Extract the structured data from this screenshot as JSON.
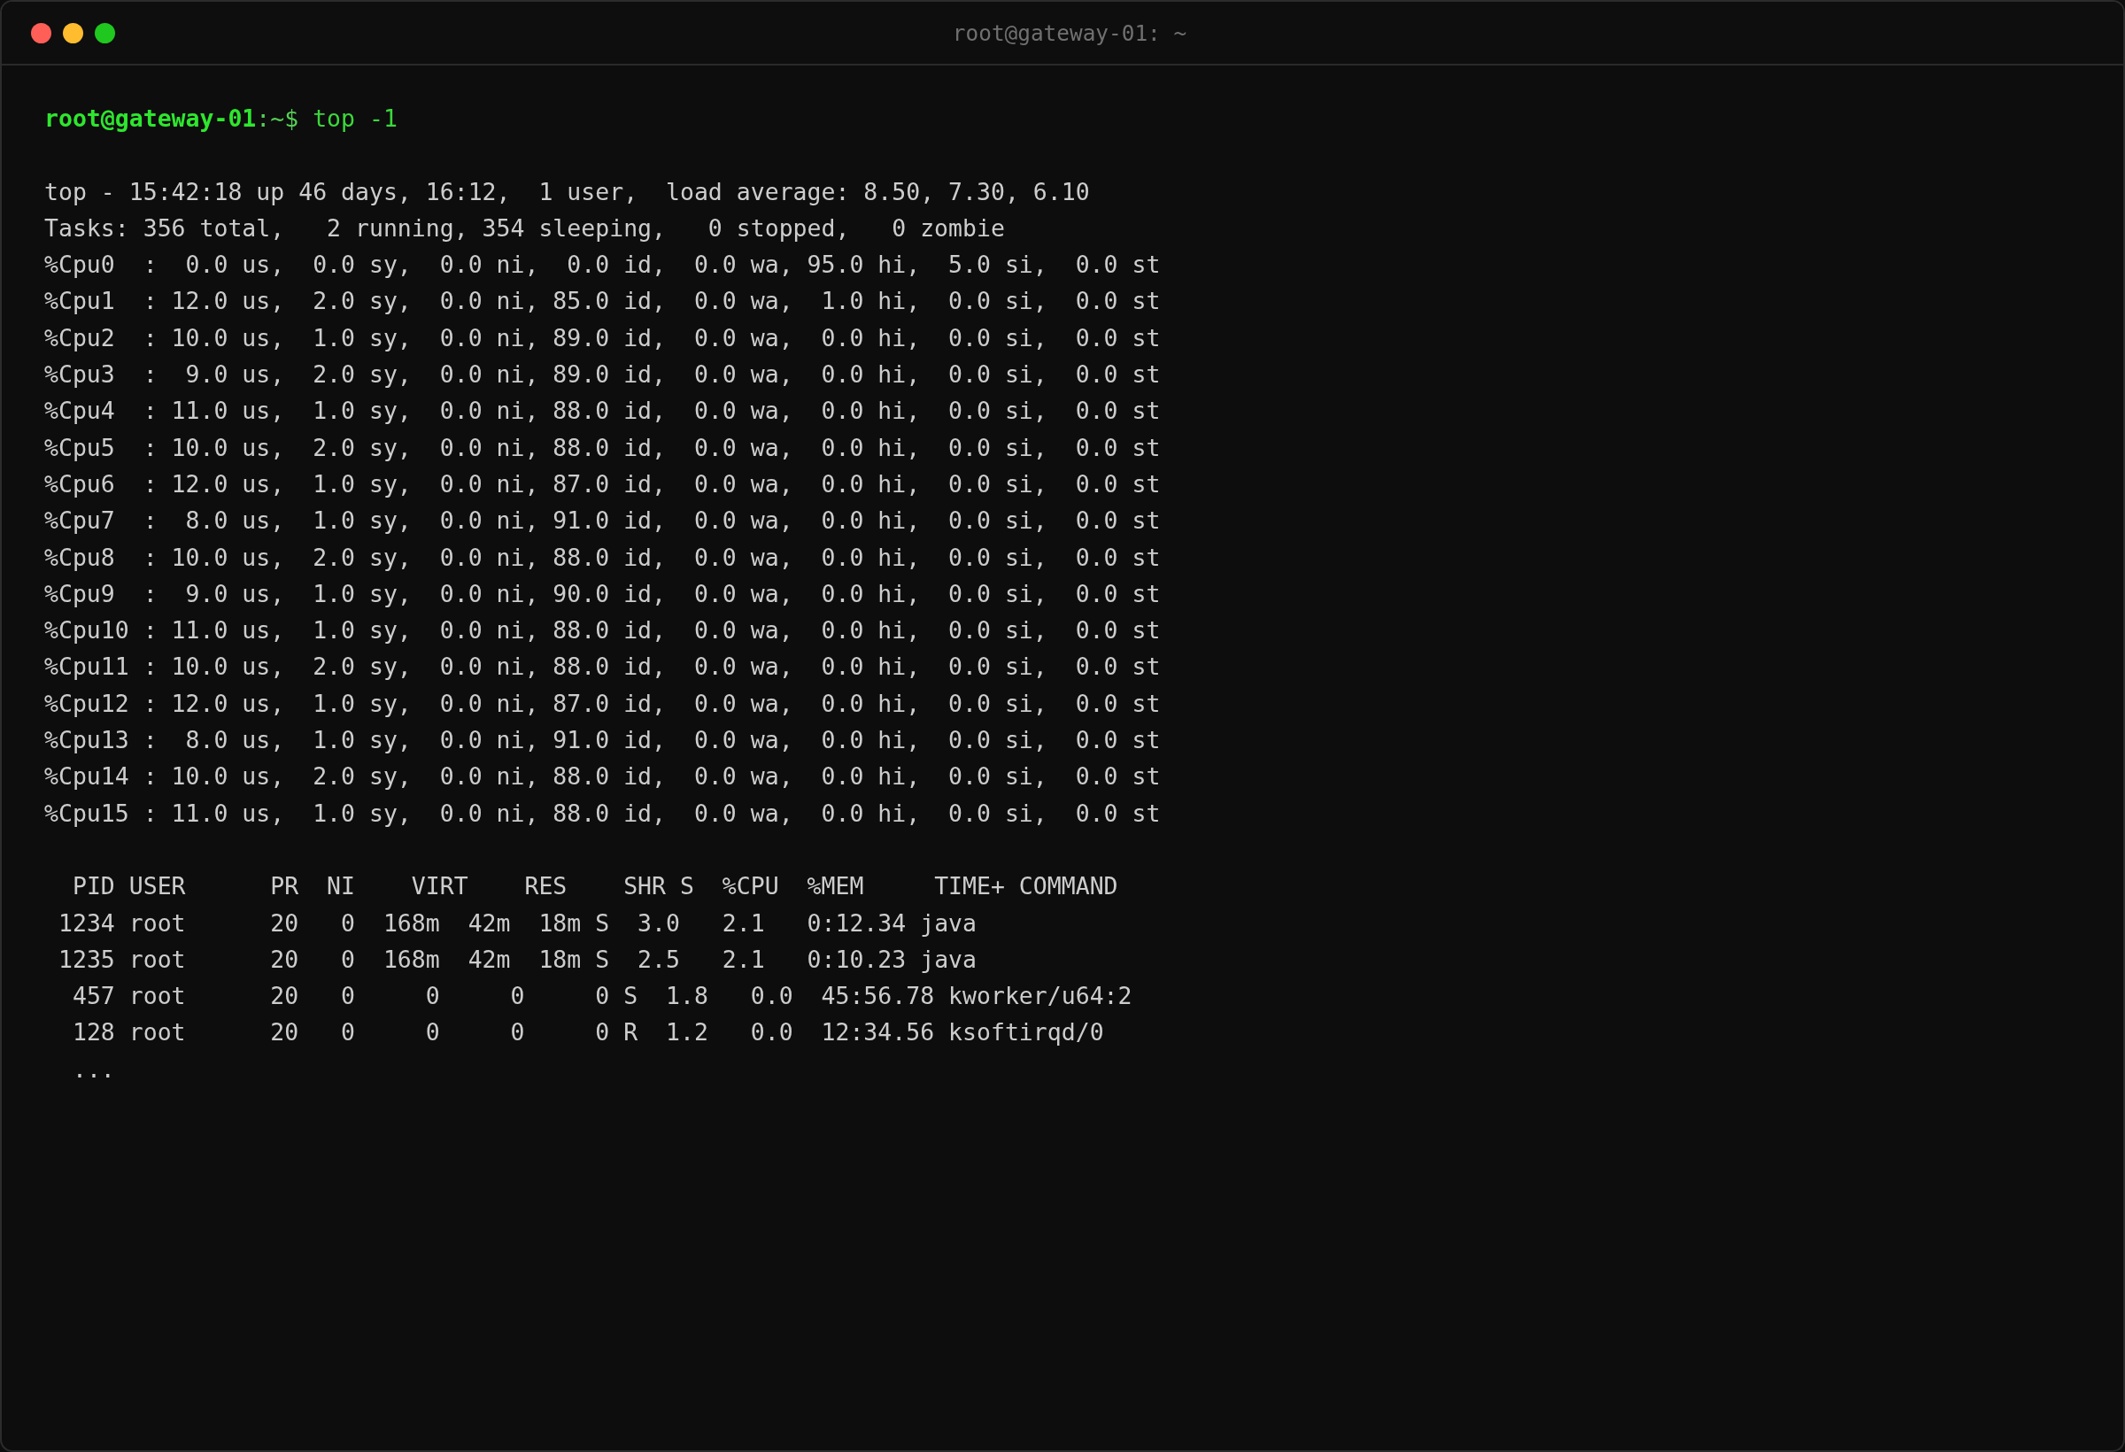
{
  "window": {
    "title": "root@gateway-01: ~"
  },
  "terminal": {
    "prompt": {
      "user_host": "root@gateway-01",
      "path": ":~$",
      "command": "top -1"
    },
    "summary_lines": [
      "top - 15:42:18 up 46 days, 16:12,  1 user,  load average: 8.50, 7.30, 6.10",
      "Tasks: 356 total,   2 running, 354 sleeping,   0 stopped,   0 zombie"
    ],
    "cpu_lines": [
      "%Cpu0  :  0.0 us,  0.0 sy,  0.0 ni,  0.0 id,  0.0 wa, 95.0 hi,  5.0 si,  0.0 st",
      "%Cpu1  : 12.0 us,  2.0 sy,  0.0 ni, 85.0 id,  0.0 wa,  1.0 hi,  0.0 si,  0.0 st",
      "%Cpu2  : 10.0 us,  1.0 sy,  0.0 ni, 89.0 id,  0.0 wa,  0.0 hi,  0.0 si,  0.0 st",
      "%Cpu3  :  9.0 us,  2.0 sy,  0.0 ni, 89.0 id,  0.0 wa,  0.0 hi,  0.0 si,  0.0 st",
      "%Cpu4  : 11.0 us,  1.0 sy,  0.0 ni, 88.0 id,  0.0 wa,  0.0 hi,  0.0 si,  0.0 st",
      "%Cpu5  : 10.0 us,  2.0 sy,  0.0 ni, 88.0 id,  0.0 wa,  0.0 hi,  0.0 si,  0.0 st",
      "%Cpu6  : 12.0 us,  1.0 sy,  0.0 ni, 87.0 id,  0.0 wa,  0.0 hi,  0.0 si,  0.0 st",
      "%Cpu7  :  8.0 us,  1.0 sy,  0.0 ni, 91.0 id,  0.0 wa,  0.0 hi,  0.0 si,  0.0 st",
      "%Cpu8  : 10.0 us,  2.0 sy,  0.0 ni, 88.0 id,  0.0 wa,  0.0 hi,  0.0 si,  0.0 st",
      "%Cpu9  :  9.0 us,  1.0 sy,  0.0 ni, 90.0 id,  0.0 wa,  0.0 hi,  0.0 si,  0.0 st",
      "%Cpu10 : 11.0 us,  1.0 sy,  0.0 ni, 88.0 id,  0.0 wa,  0.0 hi,  0.0 si,  0.0 st",
      "%Cpu11 : 10.0 us,  2.0 sy,  0.0 ni, 88.0 id,  0.0 wa,  0.0 hi,  0.0 si,  0.0 st",
      "%Cpu12 : 12.0 us,  1.0 sy,  0.0 ni, 87.0 id,  0.0 wa,  0.0 hi,  0.0 si,  0.0 st",
      "%Cpu13 :  8.0 us,  1.0 sy,  0.0 ni, 91.0 id,  0.0 wa,  0.0 hi,  0.0 si,  0.0 st",
      "%Cpu14 : 10.0 us,  2.0 sy,  0.0 ni, 88.0 id,  0.0 wa,  0.0 hi,  0.0 si,  0.0 st",
      "%Cpu15 : 11.0 us,  1.0 sy,  0.0 ni, 88.0 id,  0.0 wa,  0.0 hi,  0.0 si,  0.0 st"
    ],
    "process_table": {
      "header": "  PID USER      PR  NI    VIRT    RES    SHR S  %CPU  %MEM     TIME+ COMMAND",
      "rows": [
        " 1234 root      20   0  168m  42m  18m S  3.0   2.1   0:12.34 java",
        " 1235 root      20   0  168m  42m  18m S  2.5   2.1   0:10.23 java",
        "  457 root      20   0     0     0     0 S  1.8   0.0  45:56.78 kworker/u64:2",
        "  128 root      20   0     0     0     0 R  1.2   0.0  12:34.56 ksoftirqd/0"
      ],
      "more": "  ..."
    }
  }
}
